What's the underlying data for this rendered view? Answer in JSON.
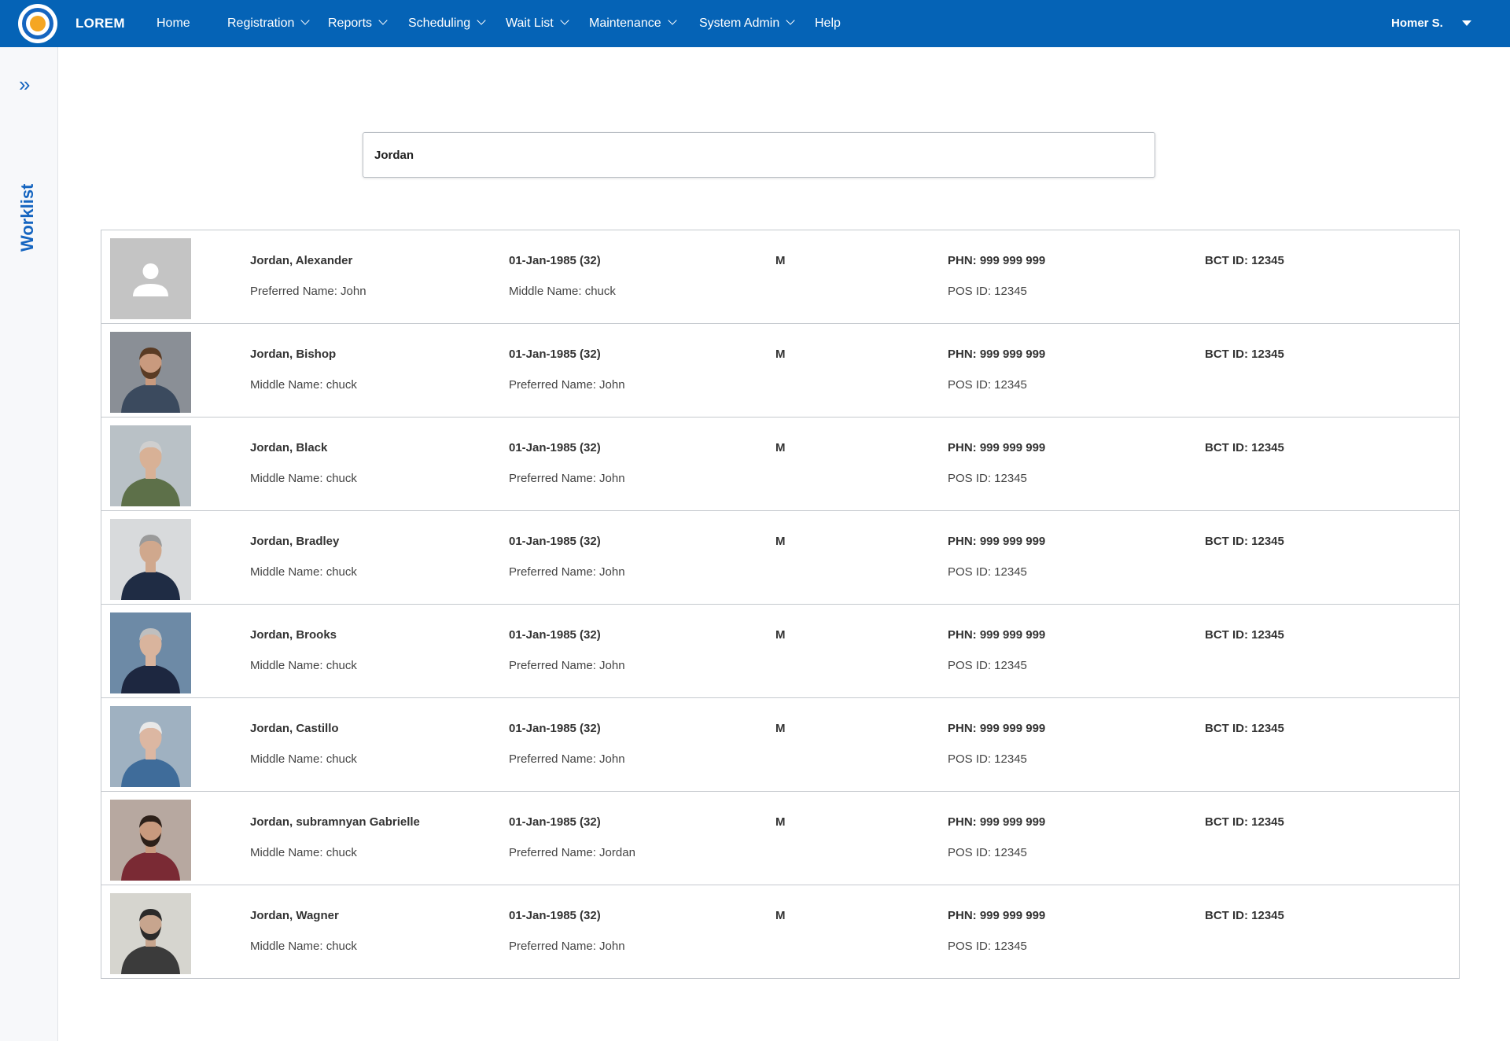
{
  "header": {
    "brand": "LOREM",
    "nav": [
      {
        "label": "Home",
        "dropdown": false
      },
      {
        "label": "Registration",
        "dropdown": true
      },
      {
        "label": "Reports",
        "dropdown": true
      },
      {
        "label": "Scheduling",
        "dropdown": true
      },
      {
        "label": "Wait List",
        "dropdown": true
      },
      {
        "label": "Maintenance",
        "dropdown": true
      },
      {
        "label": "System Admin",
        "dropdown": true
      },
      {
        "label": "Help",
        "dropdown": false
      }
    ],
    "user": "Homer S."
  },
  "sidebar": {
    "title": "Worklist"
  },
  "search": {
    "value": "Jordan"
  },
  "colors": {
    "primary": "#0563b6",
    "accent": "#f5a623"
  },
  "patients": [
    {
      "name": "Jordan, Alexander",
      "line2": "Preferred Name: John",
      "dob": "01-Jan-1985 (32)",
      "line2b": "Middle Name: chuck",
      "sex": "M",
      "phn": "PHN: 999 999 999",
      "pos": "POS ID: 12345",
      "bct": "BCT ID: 12345",
      "photo": "placeholder-avatar"
    },
    {
      "name": "Jordan, Bishop",
      "line2": "Middle Name: chuck",
      "dob": "01-Jan-1985 (32)",
      "line2b": "Preferred Name: John",
      "sex": "M",
      "phn": "PHN: 999 999 999",
      "pos": "POS ID: 12345",
      "bct": "BCT ID: 12345",
      "photo": "photo-plaid-shirt"
    },
    {
      "name": "Jordan, Black",
      "line2": "Middle Name: chuck",
      "dob": "01-Jan-1985 (32)",
      "line2b": "Preferred Name: John",
      "sex": "M",
      "phn": "PHN: 999 999 999",
      "pos": "POS ID: 12345",
      "bct": "BCT ID: 12345",
      "photo": "photo-green-shirt"
    },
    {
      "name": "Jordan, Bradley",
      "line2": "Middle Name: chuck",
      "dob": "01-Jan-1985 (32)",
      "line2b": "Preferred Name: John",
      "sex": "M",
      "phn": "PHN: 999 999 999",
      "pos": "POS ID: 12345",
      "bct": "BCT ID: 12345",
      "photo": "photo-navy-sweater"
    },
    {
      "name": "Jordan, Brooks",
      "line2": "Middle Name: chuck",
      "dob": "01-Jan-1985 (32)",
      "line2b": "Preferred Name: John",
      "sex": "M",
      "phn": "PHN: 999 999 999",
      "pos": "POS ID: 12345",
      "bct": "BCT ID: 12345",
      "photo": "photo-suit"
    },
    {
      "name": "Jordan, Castillo",
      "line2": "Middle Name: chuck",
      "dob": "01-Jan-1985 (32)",
      "line2b": "Preferred Name: John",
      "sex": "M",
      "phn": "PHN: 999 999 999",
      "pos": "POS ID: 12345",
      "bct": "BCT ID: 12345",
      "photo": "photo-elderly-denim"
    },
    {
      "name": "Jordan, subramnyan Gabrielle",
      "line2": "Middle Name: chuck",
      "dob": "01-Jan-1985 (32)",
      "line2b": "Preferred Name: Jordan",
      "sex": "M",
      "phn": "PHN: 999 999 999",
      "pos": "POS ID: 12345",
      "bct": "BCT ID: 12345",
      "photo": "photo-red-jacket"
    },
    {
      "name": "Jordan, Wagner",
      "line2": "Middle Name: chuck",
      "dob": "01-Jan-1985 (32)",
      "line2b": "Preferred Name: John",
      "sex": "M",
      "phn": "PHN: 999 999 999",
      "pos": "POS ID: 12345",
      "bct": "BCT ID: 12345",
      "photo": "photo-beard-sunglasses"
    }
  ]
}
